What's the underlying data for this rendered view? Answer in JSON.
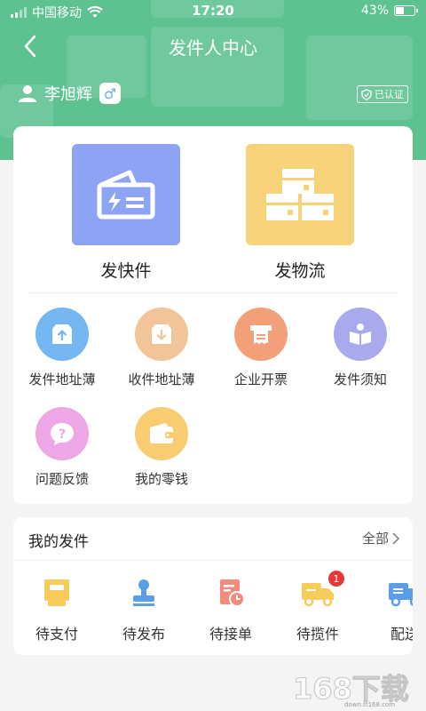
{
  "status_bar": {
    "carrier": "中国移动",
    "time": "17:20",
    "battery": "43%"
  },
  "header": {
    "title": "发件人中心"
  },
  "user": {
    "name": "李旭辉",
    "gender_symbol": "♂",
    "verified_label": "已认证"
  },
  "main_actions": [
    {
      "label": "发快件",
      "color": "#8da4f5"
    },
    {
      "label": "发物流",
      "color": "#f8d27b"
    }
  ],
  "tools": [
    {
      "label": "发件地址薄",
      "color": "#74b7f3"
    },
    {
      "label": "收件地址薄",
      "color": "#f2c49a"
    },
    {
      "label": "企业开票",
      "color": "#f1a07a"
    },
    {
      "label": "发件须知",
      "color": "#a9a9ee"
    },
    {
      "label": "问题反馈",
      "color": "#eda6e6"
    },
    {
      "label": "我的零钱",
      "color": "#f8cc70"
    }
  ],
  "orders": {
    "title": "我的发件",
    "all_label": "全部",
    "items": [
      {
        "label": "待支付",
        "badge": ""
      },
      {
        "label": "待发布",
        "badge": ""
      },
      {
        "label": "待接单",
        "badge": ""
      },
      {
        "label": "待揽件",
        "badge": "1"
      },
      {
        "label": "配送",
        "badge": ""
      }
    ]
  },
  "watermark": {
    "text": "168下载",
    "sub": "down.tt168.com"
  }
}
